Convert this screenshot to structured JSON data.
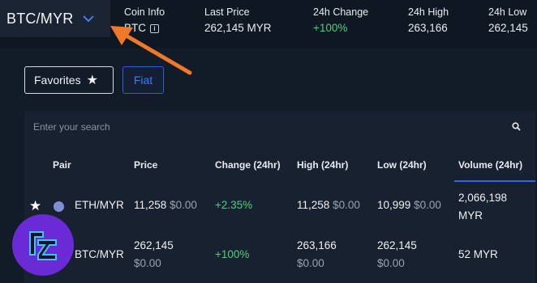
{
  "header": {
    "pair": "BTC/MYR",
    "stats": {
      "coin_info": {
        "label": "Coin Info",
        "value": "BTC"
      },
      "last_price": {
        "label": "Last Price",
        "value": "262,145 MYR"
      },
      "change_24h": {
        "label": "24h Change",
        "value": "+100%"
      },
      "high_24h": {
        "label": "24h High",
        "value": "263,166"
      },
      "low_24h": {
        "label": "24h Low",
        "value": "262,145"
      }
    }
  },
  "filters": {
    "favorites_label": "Favorites",
    "fiat_label": "Fiat"
  },
  "search": {
    "placeholder": "Enter your search"
  },
  "table": {
    "columns": [
      "Pair",
      "Price",
      "Change (24hr)",
      "High (24hr)",
      "Low (24hr)",
      "Volume (24hr)"
    ],
    "rows": [
      {
        "pair": "ETH/MYR",
        "price": "11,258",
        "price_usd": "$0.00",
        "change": "+2.35%",
        "high": "11,258",
        "high_usd": "$0.00",
        "low": "10,999",
        "low_usd": "$0.00",
        "volume": "2,066,198",
        "volume_unit": "MYR"
      },
      {
        "pair": "BTC/MYR",
        "price": "262,145",
        "price_usd": "$0.00",
        "change": "+100%",
        "high": "263,166",
        "high_usd": "$0.00",
        "low": "262,145",
        "low_usd": "$0.00",
        "volume": "52 MYR"
      }
    ]
  },
  "colors": {
    "accent": "#2f67e6",
    "positive": "#4cd080",
    "annotation_arrow": "#f0782a",
    "logo": "#6a2bd6"
  }
}
